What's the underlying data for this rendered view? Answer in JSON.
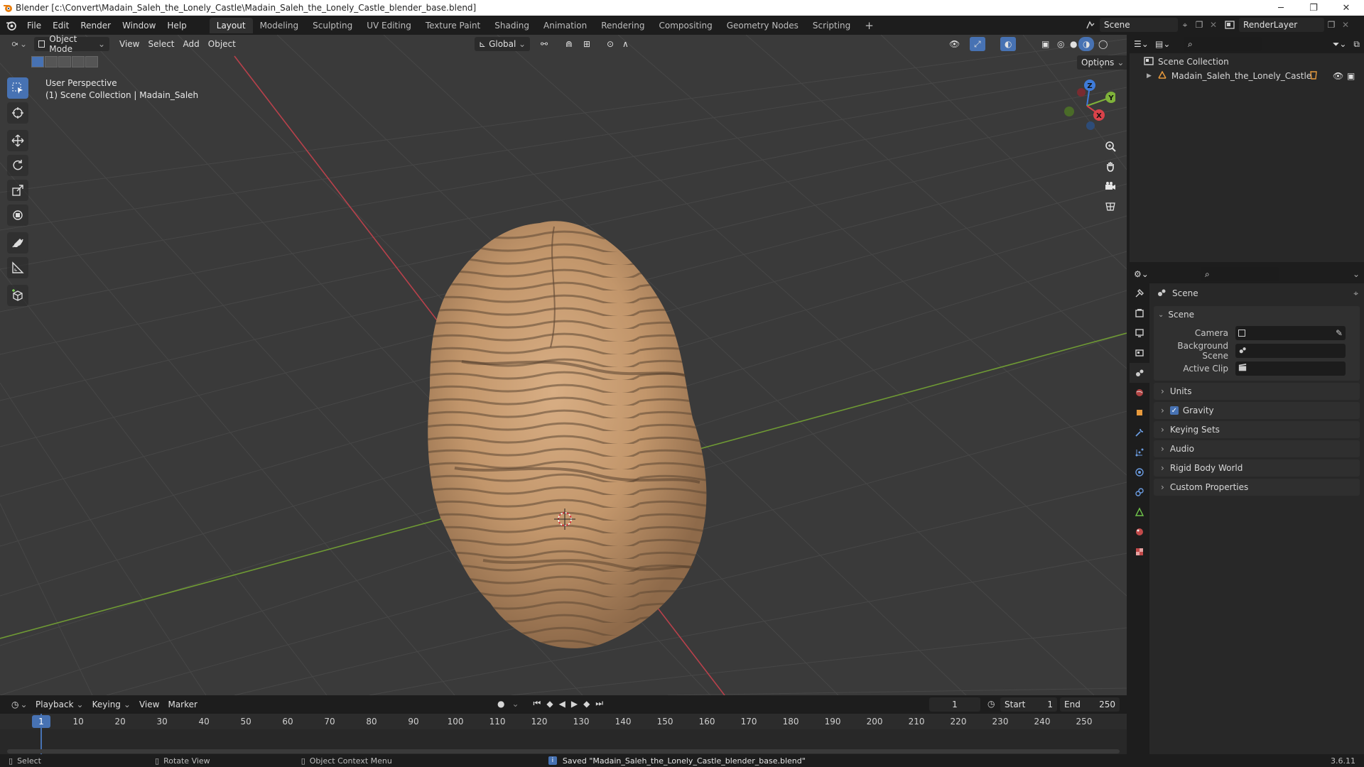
{
  "window": {
    "title": "Blender [c:\\Convert\\Madain_Saleh_the_Lonely_Castle\\Madain_Saleh_the_Lonely_Castle_blender_base.blend]",
    "minimize": "─",
    "maximize": "❐",
    "close": "✕"
  },
  "menu": [
    "File",
    "Edit",
    "Render",
    "Window",
    "Help"
  ],
  "workspaces": [
    "Layout",
    "Modeling",
    "Sculpting",
    "UV Editing",
    "Texture Paint",
    "Shading",
    "Animation",
    "Rendering",
    "Compositing",
    "Geometry Nodes",
    "Scripting"
  ],
  "workspace_add": "+",
  "scene_field": "Scene",
  "renderlayer_field": "RenderLayer",
  "viewport": {
    "mode": "Object Mode",
    "menus": [
      "View",
      "Select",
      "Add",
      "Object"
    ],
    "transform_orientation": "Global",
    "options": "Options",
    "overlay_line1": "User Perspective",
    "overlay_line2": "(1) Scene Collection | Madain_Saleh",
    "gizmo": {
      "z": "Z",
      "y": "Y",
      "x": "X"
    }
  },
  "outliner": {
    "root": "Scene Collection",
    "items": [
      {
        "label": "Madain_Saleh_the_Lonely_Castle"
      }
    ]
  },
  "properties": {
    "context_title": "Scene",
    "panel_title": "Scene",
    "fields": [
      {
        "label": "Camera",
        "value": ""
      },
      {
        "label": "Background Scene",
        "value": ""
      },
      {
        "label": "Active Clip",
        "value": ""
      }
    ],
    "subpanels": [
      {
        "label": "Units",
        "checkbox": false
      },
      {
        "label": "Gravity",
        "checkbox": true
      },
      {
        "label": "Keying Sets",
        "checkbox": false
      },
      {
        "label": "Audio",
        "checkbox": false
      },
      {
        "label": "Rigid Body World",
        "checkbox": false
      },
      {
        "label": "Custom Properties",
        "checkbox": false
      }
    ]
  },
  "timeline": {
    "menus": [
      "Playback",
      "Keying",
      "View",
      "Marker"
    ],
    "current_frame": "1",
    "start_label": "Start",
    "start_value": "1",
    "end_label": "End",
    "end_value": "250",
    "ticks": [
      "1",
      "10",
      "20",
      "30",
      "40",
      "50",
      "60",
      "70",
      "80",
      "90",
      "100",
      "110",
      "120",
      "130",
      "140",
      "150",
      "160",
      "170",
      "180",
      "190",
      "200",
      "210",
      "220",
      "230",
      "240",
      "250"
    ]
  },
  "status": {
    "select": "Select",
    "rotate": "Rotate View",
    "context_menu": "Object Context Menu",
    "message": "Saved \"Madain_Saleh_the_Lonely_Castle_blender_base.blend\"",
    "version": "3.6.11"
  },
  "colors": {
    "accent": "#4772b3",
    "x_axis": "#d9424a",
    "y_axis": "#7fb23a",
    "z_axis": "#3e7bd9",
    "rock": "#c99a6e"
  }
}
